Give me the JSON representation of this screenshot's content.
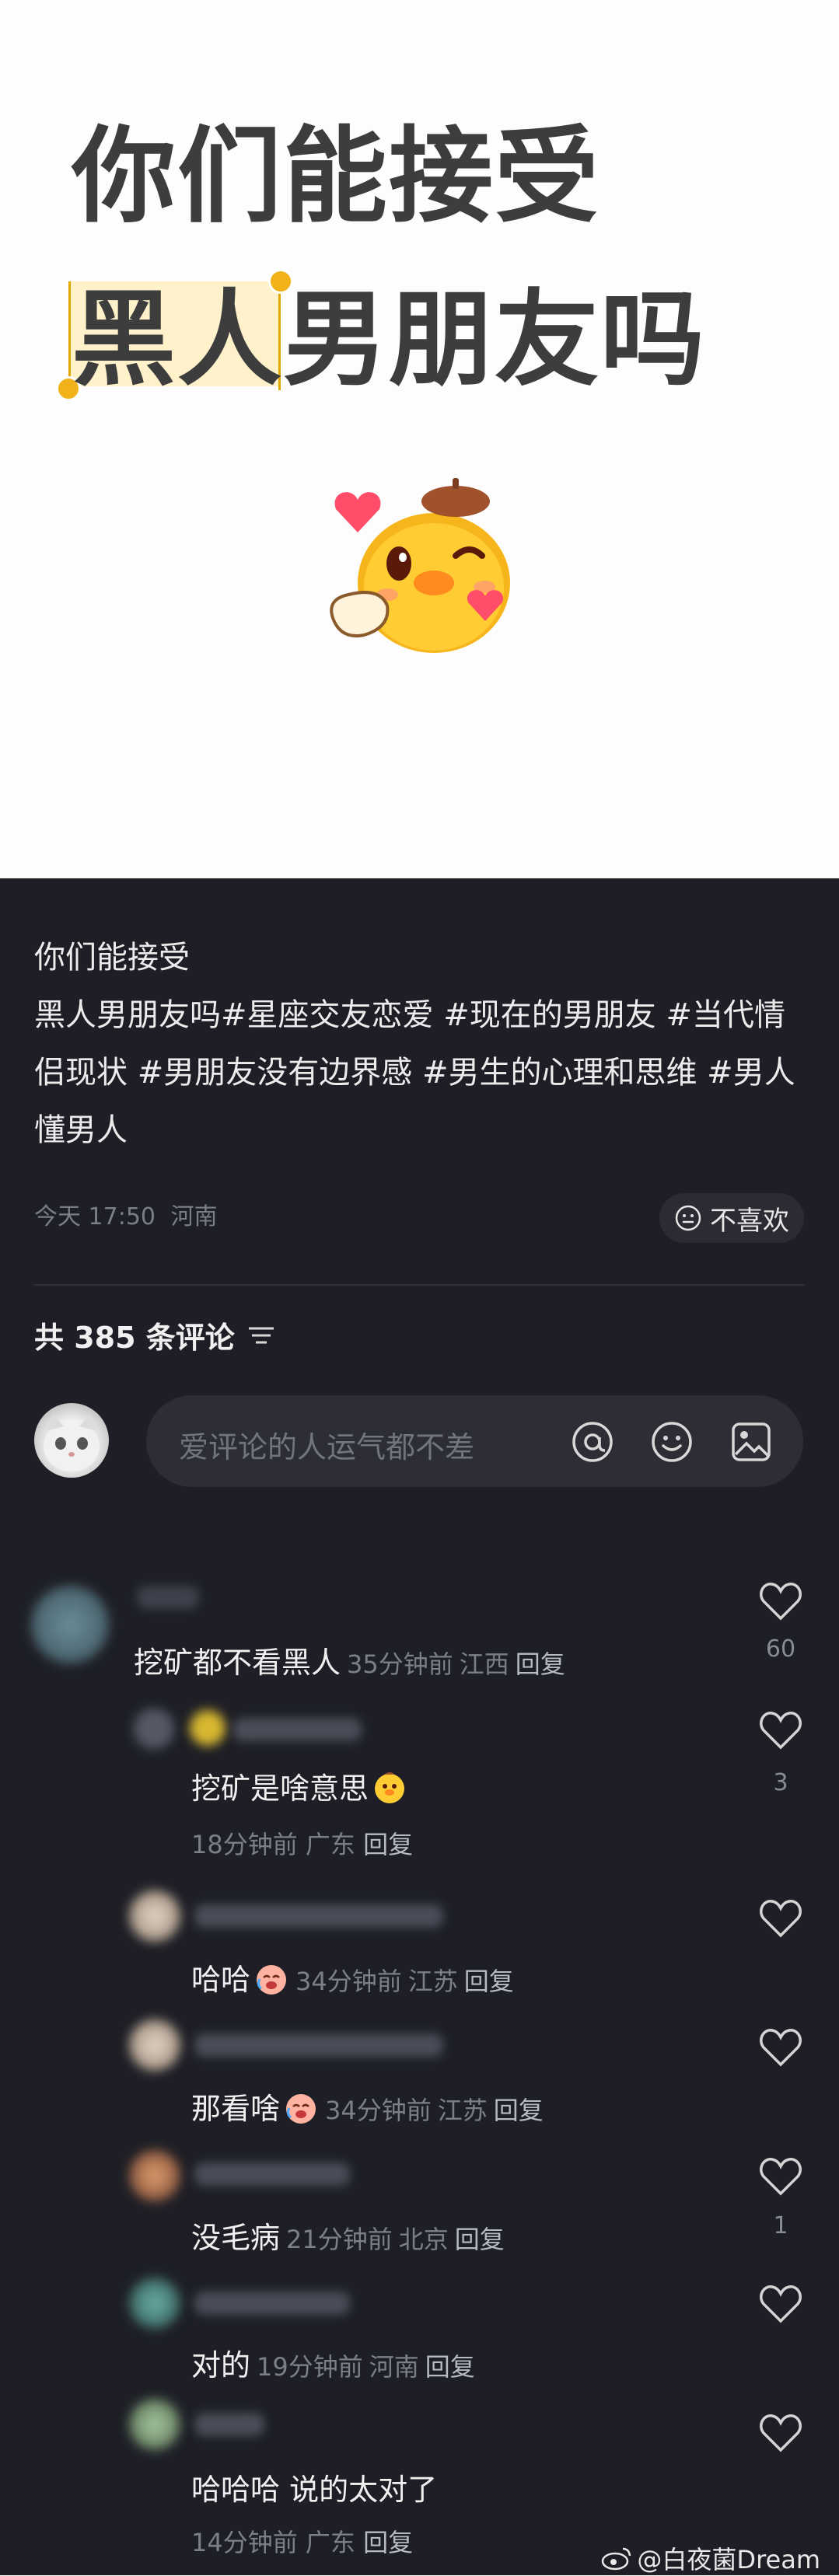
{
  "card": {
    "line1": "你们能接受",
    "line2_highlight": "黑人",
    "line2_rest": "男朋友吗"
  },
  "post": {
    "desc_line1": "你们能接受",
    "desc_line2": "黑人男朋友吗#星座交友恋爱 #现在的男朋友 #当代情侣现状 #男朋友没有边界感 #男生的心理和思维 #男人懂男人",
    "time": "今天 17:50",
    "location": "河南",
    "dislike_label": "不喜欢"
  },
  "comments_header": {
    "count_label": "共 385 条评论"
  },
  "input": {
    "placeholder": "爱评论的人运气都不差"
  },
  "comments": [
    {
      "text": "挖矿都不看黑人",
      "time": "35分钟前",
      "loc": "江西",
      "reply": "回复",
      "likes": "60"
    },
    {
      "text": "挖矿是啥意思",
      "time": "18分钟前",
      "loc": "广东",
      "reply": "回复",
      "likes": "3"
    },
    {
      "text": "哈哈",
      "time": "34分钟前",
      "loc": "江苏",
      "reply": "回复",
      "likes": ""
    },
    {
      "text": "那看啥",
      "time": "34分钟前",
      "loc": "江苏",
      "reply": "回复",
      "likes": ""
    },
    {
      "text": "没毛病",
      "time": "21分钟前",
      "loc": "北京",
      "reply": "回复",
      "likes": "1"
    },
    {
      "text": "对的",
      "time": "19分钟前",
      "loc": "河南",
      "reply": "回复",
      "likes": ""
    },
    {
      "text": "哈哈哈 说的太对了",
      "time": "14分钟前",
      "loc": "广东",
      "reply": "回复",
      "likes": ""
    }
  ],
  "watermark": "@白夜菌Dream",
  "colors": {
    "bg_dark": "#1e1f26",
    "highlight": "#fff1c9",
    "accent_yellow": "#f2b21a",
    "meta_gray": "#7d7f88"
  }
}
